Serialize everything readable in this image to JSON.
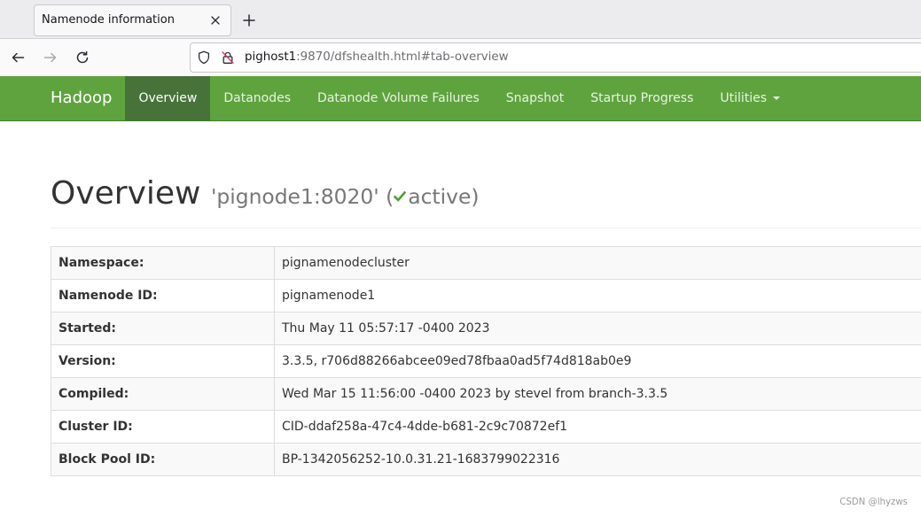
{
  "theme": {
    "navbar_bg": "#5fa33e",
    "navbar_active_bg": "#47733a",
    "status_ok": "#4c9e35"
  },
  "browser": {
    "tab_title": "Namenode information",
    "url_host": "pighost1",
    "url_path": ":9870/dfshealth.html#tab-overview",
    "icons": {
      "tab_close": "close-icon",
      "new_tab": "plus-icon",
      "back": "back-arrow-icon",
      "forward": "forward-arrow-icon",
      "reload": "reload-icon",
      "tracking_protection": "shield-icon",
      "connection": "insecure-lock-icon"
    }
  },
  "navbar": {
    "brand": "Hadoop",
    "items": [
      {
        "label": "Overview",
        "active": true
      },
      {
        "label": "Datanodes",
        "active": false
      },
      {
        "label": "Datanode Volume Failures",
        "active": false
      },
      {
        "label": "Snapshot",
        "active": false
      },
      {
        "label": "Startup Progress",
        "active": false
      },
      {
        "label": "Utilities",
        "active": false,
        "dropdown": true,
        "icon": "caret-down-icon"
      }
    ]
  },
  "overview": {
    "title": "Overview",
    "subtitle_prefix": "'pignode1:8020' (",
    "status_icon": "check-icon",
    "status": "active",
    "subtitle_suffix": ")"
  },
  "info_table": [
    {
      "label": "Namespace:",
      "value": "pignamenodecluster"
    },
    {
      "label": "Namenode ID:",
      "value": "pignamenode1"
    },
    {
      "label": "Started:",
      "value": "Thu May 11 05:57:17 -0400 2023"
    },
    {
      "label": "Version:",
      "value": "3.3.5, r706d88266abcee09ed78fbaa0ad5f74d818ab0e9"
    },
    {
      "label": "Compiled:",
      "value": "Wed Mar 15 11:56:00 -0400 2023 by stevel from branch-3.3.5"
    },
    {
      "label": "Cluster ID:",
      "value": "CID-ddaf258a-47c4-4dde-b681-2c9c70872ef1"
    },
    {
      "label": "Block Pool ID:",
      "value": "BP-1342056252-10.0.31.21-1683799022316"
    }
  ],
  "watermark": "CSDN @lhyzws"
}
